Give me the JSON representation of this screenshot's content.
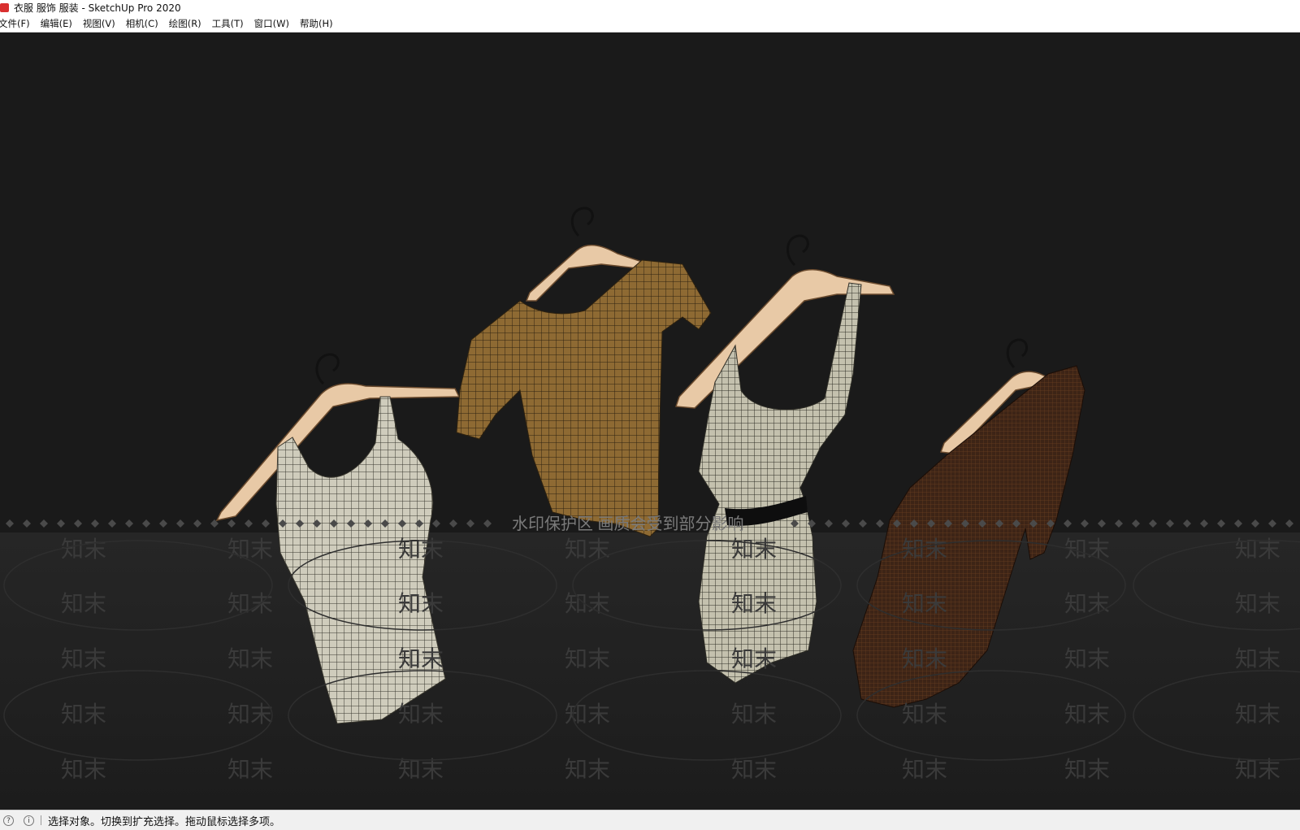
{
  "window": {
    "title": "衣服 服饰 服装 - SketchUp Pro 2020"
  },
  "menu": {
    "items": [
      {
        "label": "文件(F)"
      },
      {
        "label": "编辑(E)"
      },
      {
        "label": "视图(V)"
      },
      {
        "label": "相机(C)"
      },
      {
        "label": "绘图(R)"
      },
      {
        "label": "工具(T)"
      },
      {
        "label": "窗口(W)"
      },
      {
        "label": "帮助(H)"
      }
    ]
  },
  "viewport": {
    "background": "#1a1a1a",
    "garments": [
      {
        "name": "tank-top",
        "color": "#c9c6b6"
      },
      {
        "name": "shirt",
        "color": "#8a6630"
      },
      {
        "name": "dress",
        "color": "#bdbaa8"
      },
      {
        "name": "long-sleeve-top",
        "color": "#4a2a1a"
      }
    ],
    "watermark": {
      "banner_text": "水印保护区   画质会受到部分影响",
      "logo_text": "知末"
    }
  },
  "status": {
    "message": "选择对象。切换到扩充选择。拖动鼠标选择多项。",
    "icons": [
      "info-icon",
      "help-icon"
    ]
  }
}
